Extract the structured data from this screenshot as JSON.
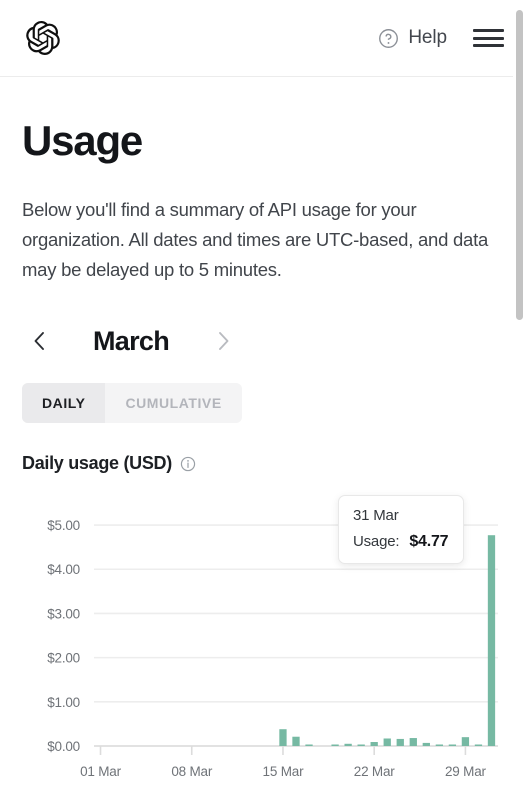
{
  "header": {
    "logo_name": "openai-logo",
    "help_label": "Help",
    "help_icon": "question-circle-icon",
    "menu_icon": "hamburger-menu-icon"
  },
  "main": {
    "title": "Usage",
    "description": "Below you'll find a summary of API usage for your organization. All dates and times are UTC-based, and data may be delayed up to 5 minutes."
  },
  "month_nav": {
    "prev_icon": "chevron-left-icon",
    "next_icon": "chevron-right-icon",
    "month": "March"
  },
  "toggle": {
    "daily_label": "DAILY",
    "cumulative_label": "CUMULATIVE",
    "active": "DAILY"
  },
  "chart_header": {
    "title": "Daily usage (USD)",
    "info_icon": "info-circle-icon"
  },
  "tooltip": {
    "date": "31 Mar",
    "usage_label": "Usage:",
    "usage_value": "$4.77"
  },
  "colors": {
    "bar": "#76b9a3",
    "grid": "#ededed",
    "axis_text": "#6f7378",
    "accent_text": "#14161a",
    "toggle_active_bg": "#eaeaec",
    "toggle_track_bg": "#f4f4f5",
    "scrollbar": "#c3c3c3"
  },
  "chart_data": {
    "type": "bar",
    "title": "Daily usage (USD)",
    "xlabel": "",
    "ylabel": "",
    "ylim": [
      0,
      5.25
    ],
    "ytick_labels": [
      "$0.00",
      "$1.00",
      "$2.00",
      "$3.00",
      "$4.00",
      "$5.00"
    ],
    "ytick_values": [
      0,
      1,
      2,
      3,
      4,
      5
    ],
    "xtick_labels": [
      "01 Mar",
      "08 Mar",
      "15 Mar",
      "22 Mar",
      "29 Mar"
    ],
    "xtick_indices": [
      0,
      7,
      14,
      21,
      28
    ],
    "grid": true,
    "legend": "none",
    "categories": [
      "01 Mar",
      "02 Mar",
      "03 Mar",
      "04 Mar",
      "05 Mar",
      "06 Mar",
      "07 Mar",
      "08 Mar",
      "09 Mar",
      "10 Mar",
      "11 Mar",
      "12 Mar",
      "13 Mar",
      "14 Mar",
      "15 Mar",
      "16 Mar",
      "17 Mar",
      "18 Mar",
      "19 Mar",
      "20 Mar",
      "21 Mar",
      "22 Mar",
      "23 Mar",
      "24 Mar",
      "25 Mar",
      "26 Mar",
      "27 Mar",
      "28 Mar",
      "29 Mar",
      "30 Mar",
      "31 Mar"
    ],
    "values": [
      0,
      0,
      0,
      0,
      0,
      0,
      0,
      0,
      0,
      0,
      0,
      0,
      0,
      0,
      0.38,
      0.21,
      0.01,
      0,
      0.02,
      0.05,
      0.03,
      0.09,
      0.17,
      0.16,
      0.18,
      0.07,
      0.01,
      0.02,
      0.2,
      0.03,
      4.77
    ],
    "highlighted_category": "31 Mar",
    "highlighted_value": 4.77
  }
}
